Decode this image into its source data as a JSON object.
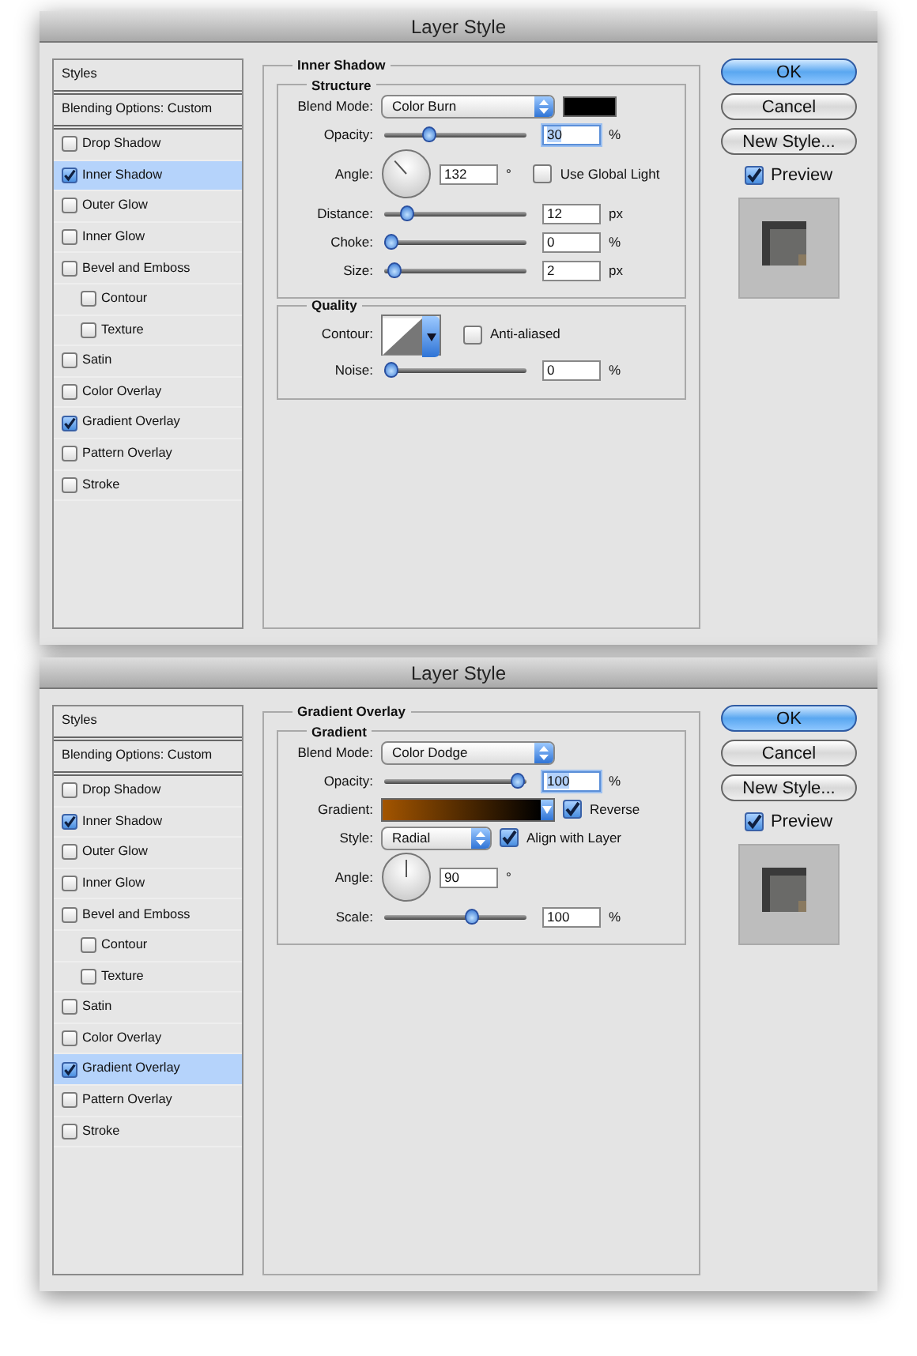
{
  "dialogs": [
    {
      "title": "Layer Style",
      "sidebar": [
        {
          "kind": "header",
          "label": "Styles",
          "selected": false
        },
        {
          "kind": "header",
          "label": "Blending Options: Custom",
          "selected": false
        },
        {
          "kind": "check",
          "label": "Drop Shadow",
          "checked": false,
          "selected": false
        },
        {
          "kind": "check",
          "label": "Inner Shadow",
          "checked": true,
          "selected": true
        },
        {
          "kind": "check",
          "label": "Outer Glow",
          "checked": false,
          "selected": false
        },
        {
          "kind": "check",
          "label": "Inner Glow",
          "checked": false,
          "selected": false
        },
        {
          "kind": "check",
          "label": "Bevel and Emboss",
          "checked": false,
          "selected": false,
          "children": [
            {
              "kind": "check",
              "label": "Contour",
              "checked": false,
              "selected": false
            },
            {
              "kind": "check",
              "label": "Texture",
              "checked": false,
              "selected": false
            }
          ]
        },
        {
          "kind": "check",
          "label": "Satin",
          "checked": false,
          "selected": false
        },
        {
          "kind": "check",
          "label": "Color Overlay",
          "checked": false,
          "selected": false
        },
        {
          "kind": "check",
          "label": "Gradient Overlay",
          "checked": true,
          "selected": false
        },
        {
          "kind": "check",
          "label": "Pattern Overlay",
          "checked": false,
          "selected": false
        },
        {
          "kind": "check",
          "label": "Stroke",
          "checked": false,
          "selected": false
        }
      ],
      "panel": {
        "title": "Inner Shadow",
        "groups": [
          {
            "title": "Structure",
            "rows": [
              {
                "kind": "select",
                "label": "Blend Mode:",
                "value": "Color Burn",
                "color": "#000000"
              },
              {
                "kind": "slider",
                "label": "Opacity:",
                "level": 0.3,
                "value": "30",
                "unit": "%",
                "focused": true
              },
              {
                "kind": "angle",
                "label": "Angle:",
                "value": "132",
                "unit": "°",
                "option": {
                  "label": "Use Global Light",
                  "checked": false
                }
              },
              {
                "kind": "slider",
                "label": "Distance:",
                "level": 0.12,
                "value": "12",
                "unit": "px",
                "focused": false
              },
              {
                "kind": "slider",
                "label": "Choke:",
                "level": 0,
                "value": "0",
                "unit": "%",
                "focused": false
              },
              {
                "kind": "slider",
                "label": "Size:",
                "level": 0.02,
                "value": "2",
                "unit": "px",
                "focused": false
              }
            ]
          },
          {
            "title": "Quality",
            "rows": [
              {
                "kind": "contour",
                "label": "Contour:",
                "option": {
                  "label": "Anti-aliased",
                  "checked": false
                }
              },
              {
                "kind": "slider",
                "label": "Noise:",
                "level": 0,
                "value": "0",
                "unit": "%",
                "focused": false
              }
            ]
          }
        ]
      },
      "buttons": [
        {
          "label": "OK",
          "default": true
        },
        {
          "label": "Cancel",
          "default": false
        },
        {
          "label": "New Style...",
          "default": false
        }
      ],
      "preview": {
        "label": "Preview",
        "checked": true
      }
    },
    {
      "title": "Layer Style",
      "sidebar": [
        {
          "kind": "header",
          "label": "Styles",
          "selected": false
        },
        {
          "kind": "header",
          "label": "Blending Options: Custom",
          "selected": false
        },
        {
          "kind": "check",
          "label": "Drop Shadow",
          "checked": false,
          "selected": false
        },
        {
          "kind": "check",
          "label": "Inner Shadow",
          "checked": true,
          "selected": false
        },
        {
          "kind": "check",
          "label": "Outer Glow",
          "checked": false,
          "selected": false
        },
        {
          "kind": "check",
          "label": "Inner Glow",
          "checked": false,
          "selected": false
        },
        {
          "kind": "check",
          "label": "Bevel and Emboss",
          "checked": false,
          "selected": false,
          "children": [
            {
              "kind": "check",
              "label": "Contour",
              "checked": false,
              "selected": false
            },
            {
              "kind": "check",
              "label": "Texture",
              "checked": false,
              "selected": false
            }
          ]
        },
        {
          "kind": "check",
          "label": "Satin",
          "checked": false,
          "selected": false
        },
        {
          "kind": "check",
          "label": "Color Overlay",
          "checked": false,
          "selected": false
        },
        {
          "kind": "check",
          "label": "Gradient Overlay",
          "checked": true,
          "selected": true
        },
        {
          "kind": "check",
          "label": "Pattern Overlay",
          "checked": false,
          "selected": false
        },
        {
          "kind": "check",
          "label": "Stroke",
          "checked": false,
          "selected": false
        }
      ],
      "panel": {
        "title": "Gradient Overlay",
        "groups": [
          {
            "title": "Gradient",
            "rows": [
              {
                "kind": "select",
                "label": "Blend Mode:",
                "value": "Color Dodge"
              },
              {
                "kind": "slider",
                "label": "Opacity:",
                "level": 1,
                "value": "100",
                "unit": "%",
                "focused": true
              },
              {
                "kind": "gradient",
                "label": "Gradient:",
                "option": {
                  "label": "Reverse",
                  "checked": true
                }
              },
              {
                "kind": "select",
                "label": "Style:",
                "value": "Radial",
                "option": {
                  "label": "Align with Layer",
                  "checked": true
                }
              },
              {
                "kind": "angle",
                "label": "Angle:",
                "value": "90",
                "unit": "°"
              },
              {
                "kind": "slider",
                "label": "Scale:",
                "level": 0.64,
                "value": "100",
                "unit": "%",
                "focused": false
              }
            ]
          }
        ]
      },
      "buttons": [
        {
          "label": "OK",
          "default": true
        },
        {
          "label": "Cancel",
          "default": false
        },
        {
          "label": "New Style...",
          "default": false
        }
      ],
      "preview": {
        "label": "Preview",
        "checked": true
      }
    }
  ]
}
